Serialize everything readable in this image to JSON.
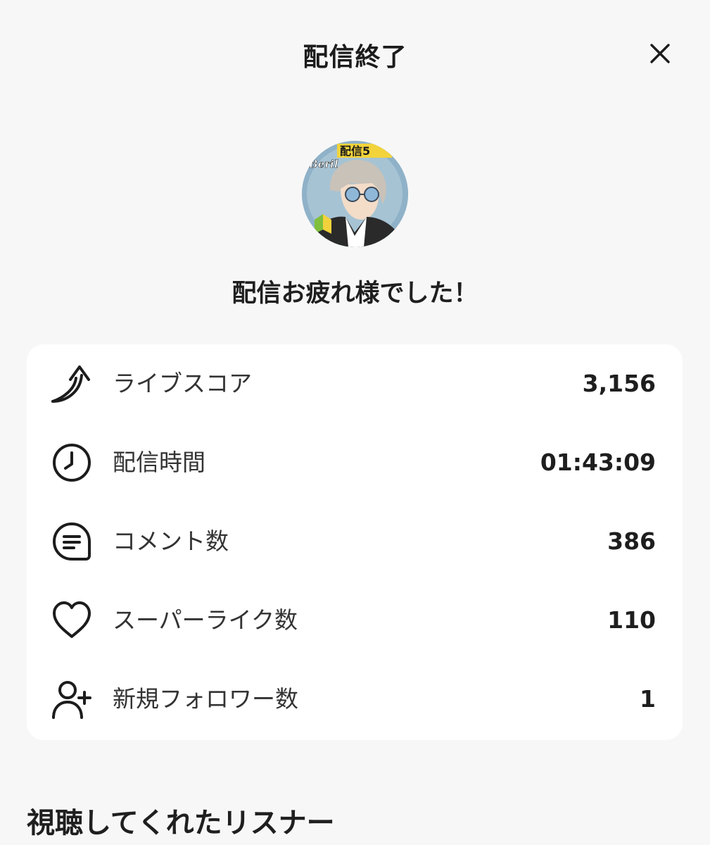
{
  "header": {
    "title": "配信終了",
    "close_icon": "close-icon"
  },
  "profile": {
    "avatar_texts": [
      "配信5",
      "Beril"
    ],
    "greeting": "配信お疲れ様でした！"
  },
  "stats": [
    {
      "icon": "trend-arrow-icon",
      "label": "ライブスコア",
      "value": "3,156"
    },
    {
      "icon": "clock-icon",
      "label": "配信時間",
      "value": "01:43:09"
    },
    {
      "icon": "comment-icon",
      "label": "コメント数",
      "value": "386"
    },
    {
      "icon": "heart-icon",
      "label": "スーパーライク数",
      "value": "110"
    },
    {
      "icon": "add-user-icon",
      "label": "新規フォロワー数",
      "value": "1"
    }
  ],
  "listeners": {
    "title": "視聴してくれたリスナー"
  },
  "colors": {
    "background": "#f7f7f7",
    "card": "#ffffff",
    "text": "#222222"
  }
}
